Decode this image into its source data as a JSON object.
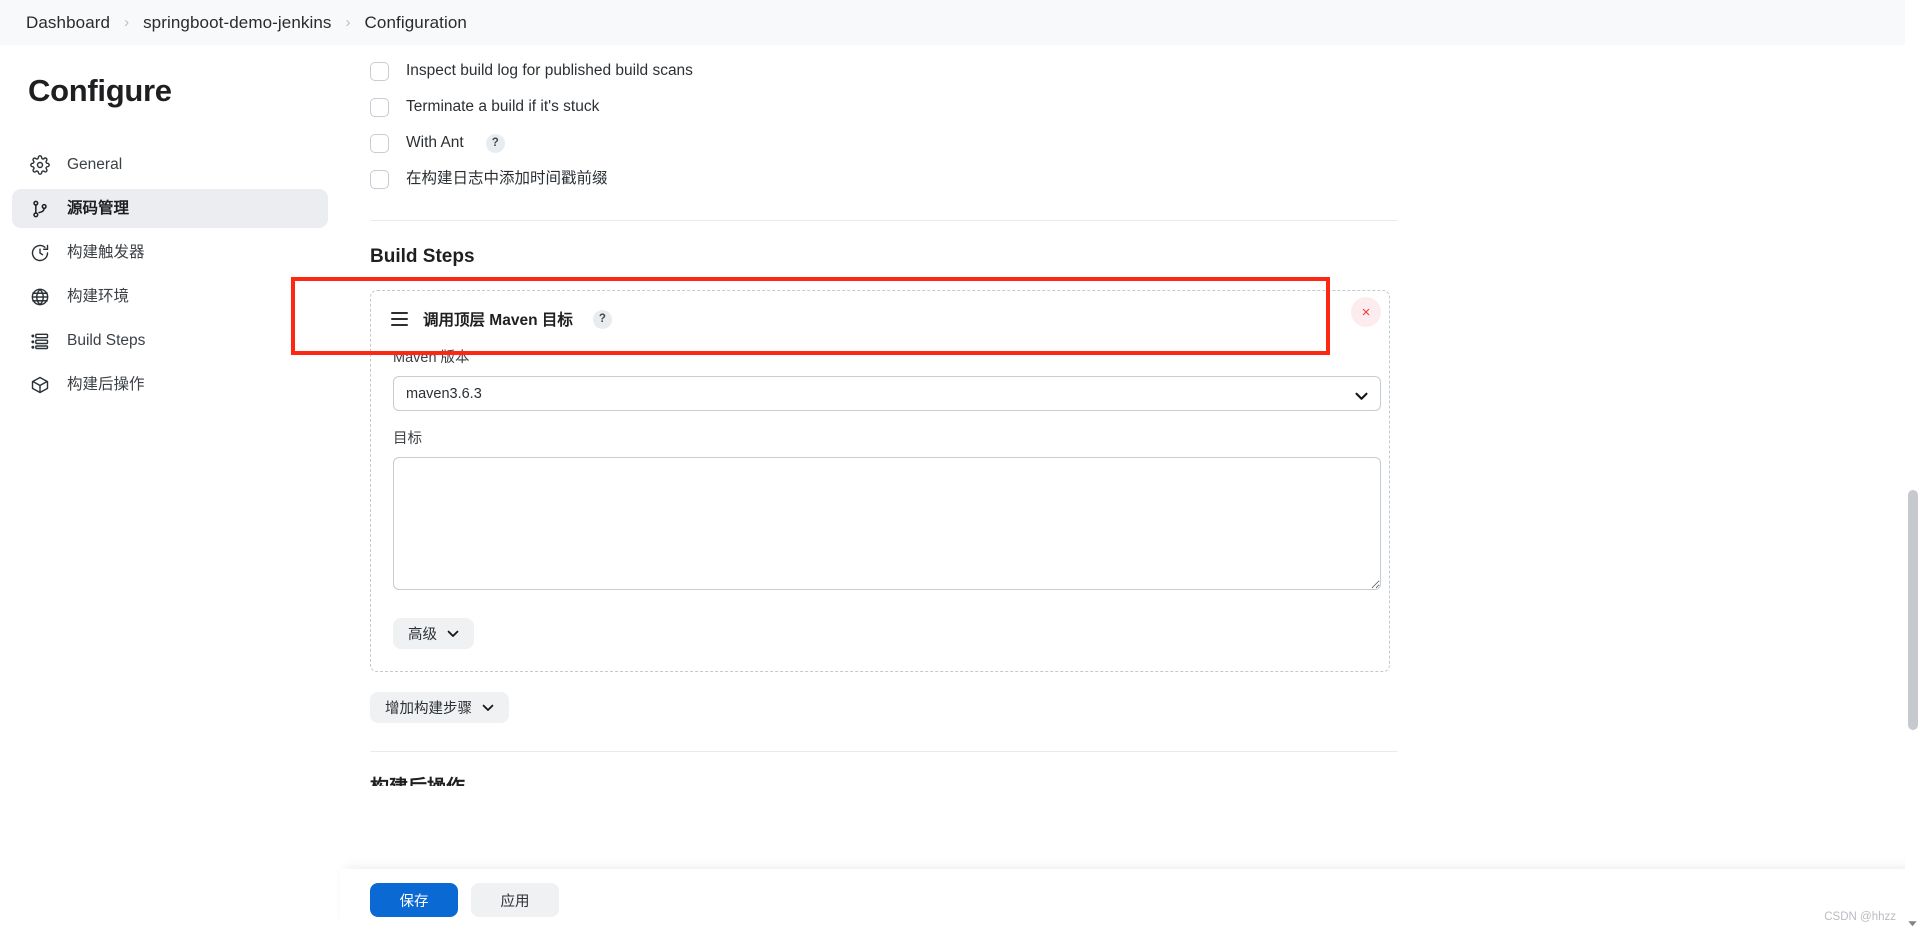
{
  "breadcrumb": {
    "items": [
      {
        "label": "Dashboard"
      },
      {
        "label": "springboot-demo-jenkins"
      },
      {
        "label": "Configuration"
      }
    ],
    "separator": "›"
  },
  "sidebar": {
    "title": "Configure",
    "items": [
      {
        "label": "General",
        "icon": "gear-icon",
        "active": false
      },
      {
        "label": "源码管理",
        "icon": "git-branch-icon",
        "active": true
      },
      {
        "label": "构建触发器",
        "icon": "clock-icon",
        "active": false
      },
      {
        "label": "构建环境",
        "icon": "globe-icon",
        "active": false
      },
      {
        "label": "Build Steps",
        "icon": "list-icon",
        "active": false
      },
      {
        "label": "构建后操作",
        "icon": "package-icon",
        "active": false
      }
    ]
  },
  "main": {
    "checkboxes": [
      {
        "label": "Inspect build log for published build scans",
        "checked": false,
        "help": false
      },
      {
        "label": "Terminate a build if it's stuck",
        "checked": false,
        "help": false
      },
      {
        "label": "With Ant",
        "checked": false,
        "help": true,
        "help_label": "?"
      },
      {
        "label": "在构建日志中添加时间戳前缀",
        "checked": false,
        "help": false
      }
    ],
    "build_steps": {
      "section_title": "Build Steps",
      "step": {
        "title": "调用顶层 Maven 目标",
        "help_label": "?",
        "delete_label": "×",
        "maven_version": {
          "label": "Maven 版本",
          "value": "maven3.6.3",
          "options": [
            "maven3.6.3"
          ]
        },
        "goals": {
          "label": "目标",
          "value": "",
          "placeholder": ""
        },
        "advanced_button": "高级"
      },
      "add_step_button": "增加构建步骤"
    },
    "next_section_title": "构建后操作"
  },
  "footer": {
    "save_label": "保存",
    "apply_label": "应用"
  },
  "watermark": "CSDN @hhzz",
  "colors": {
    "primary_button": "#0b69d4",
    "annotation_box": "#fe2712",
    "delete_icon": "#ee3b39",
    "sidebar_active_bg": "#ebedf0",
    "breadcrumb_bg": "#f8f9fa"
  }
}
